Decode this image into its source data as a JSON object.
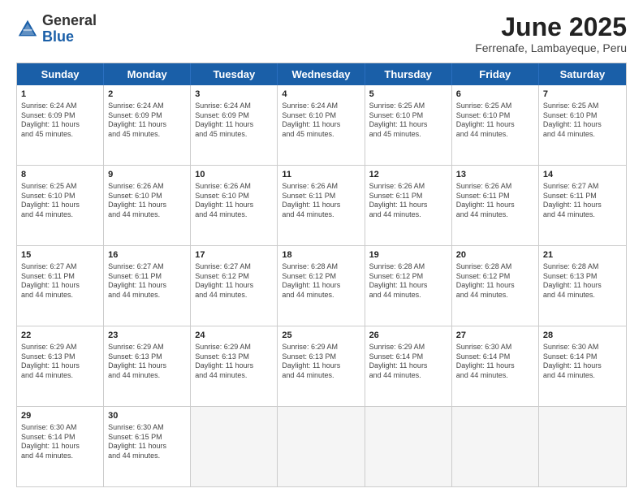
{
  "header": {
    "logo_general": "General",
    "logo_blue": "Blue",
    "month_title": "June 2025",
    "location": "Ferrenafe, Lambayeque, Peru"
  },
  "weekdays": [
    "Sunday",
    "Monday",
    "Tuesday",
    "Wednesday",
    "Thursday",
    "Friday",
    "Saturday"
  ],
  "rows": [
    [
      {
        "day": "1",
        "lines": [
          "Sunrise: 6:24 AM",
          "Sunset: 6:09 PM",
          "Daylight: 11 hours",
          "and 45 minutes."
        ]
      },
      {
        "day": "2",
        "lines": [
          "Sunrise: 6:24 AM",
          "Sunset: 6:09 PM",
          "Daylight: 11 hours",
          "and 45 minutes."
        ]
      },
      {
        "day": "3",
        "lines": [
          "Sunrise: 6:24 AM",
          "Sunset: 6:09 PM",
          "Daylight: 11 hours",
          "and 45 minutes."
        ]
      },
      {
        "day": "4",
        "lines": [
          "Sunrise: 6:24 AM",
          "Sunset: 6:10 PM",
          "Daylight: 11 hours",
          "and 45 minutes."
        ]
      },
      {
        "day": "5",
        "lines": [
          "Sunrise: 6:25 AM",
          "Sunset: 6:10 PM",
          "Daylight: 11 hours",
          "and 45 minutes."
        ]
      },
      {
        "day": "6",
        "lines": [
          "Sunrise: 6:25 AM",
          "Sunset: 6:10 PM",
          "Daylight: 11 hours",
          "and 44 minutes."
        ]
      },
      {
        "day": "7",
        "lines": [
          "Sunrise: 6:25 AM",
          "Sunset: 6:10 PM",
          "Daylight: 11 hours",
          "and 44 minutes."
        ]
      }
    ],
    [
      {
        "day": "8",
        "lines": [
          "Sunrise: 6:25 AM",
          "Sunset: 6:10 PM",
          "Daylight: 11 hours",
          "and 44 minutes."
        ]
      },
      {
        "day": "9",
        "lines": [
          "Sunrise: 6:26 AM",
          "Sunset: 6:10 PM",
          "Daylight: 11 hours",
          "and 44 minutes."
        ]
      },
      {
        "day": "10",
        "lines": [
          "Sunrise: 6:26 AM",
          "Sunset: 6:10 PM",
          "Daylight: 11 hours",
          "and 44 minutes."
        ]
      },
      {
        "day": "11",
        "lines": [
          "Sunrise: 6:26 AM",
          "Sunset: 6:11 PM",
          "Daylight: 11 hours",
          "and 44 minutes."
        ]
      },
      {
        "day": "12",
        "lines": [
          "Sunrise: 6:26 AM",
          "Sunset: 6:11 PM",
          "Daylight: 11 hours",
          "and 44 minutes."
        ]
      },
      {
        "day": "13",
        "lines": [
          "Sunrise: 6:26 AM",
          "Sunset: 6:11 PM",
          "Daylight: 11 hours",
          "and 44 minutes."
        ]
      },
      {
        "day": "14",
        "lines": [
          "Sunrise: 6:27 AM",
          "Sunset: 6:11 PM",
          "Daylight: 11 hours",
          "and 44 minutes."
        ]
      }
    ],
    [
      {
        "day": "15",
        "lines": [
          "Sunrise: 6:27 AM",
          "Sunset: 6:11 PM",
          "Daylight: 11 hours",
          "and 44 minutes."
        ]
      },
      {
        "day": "16",
        "lines": [
          "Sunrise: 6:27 AM",
          "Sunset: 6:11 PM",
          "Daylight: 11 hours",
          "and 44 minutes."
        ]
      },
      {
        "day": "17",
        "lines": [
          "Sunrise: 6:27 AM",
          "Sunset: 6:12 PM",
          "Daylight: 11 hours",
          "and 44 minutes."
        ]
      },
      {
        "day": "18",
        "lines": [
          "Sunrise: 6:28 AM",
          "Sunset: 6:12 PM",
          "Daylight: 11 hours",
          "and 44 minutes."
        ]
      },
      {
        "day": "19",
        "lines": [
          "Sunrise: 6:28 AM",
          "Sunset: 6:12 PM",
          "Daylight: 11 hours",
          "and 44 minutes."
        ]
      },
      {
        "day": "20",
        "lines": [
          "Sunrise: 6:28 AM",
          "Sunset: 6:12 PM",
          "Daylight: 11 hours",
          "and 44 minutes."
        ]
      },
      {
        "day": "21",
        "lines": [
          "Sunrise: 6:28 AM",
          "Sunset: 6:13 PM",
          "Daylight: 11 hours",
          "and 44 minutes."
        ]
      }
    ],
    [
      {
        "day": "22",
        "lines": [
          "Sunrise: 6:29 AM",
          "Sunset: 6:13 PM",
          "Daylight: 11 hours",
          "and 44 minutes."
        ]
      },
      {
        "day": "23",
        "lines": [
          "Sunrise: 6:29 AM",
          "Sunset: 6:13 PM",
          "Daylight: 11 hours",
          "and 44 minutes."
        ]
      },
      {
        "day": "24",
        "lines": [
          "Sunrise: 6:29 AM",
          "Sunset: 6:13 PM",
          "Daylight: 11 hours",
          "and 44 minutes."
        ]
      },
      {
        "day": "25",
        "lines": [
          "Sunrise: 6:29 AM",
          "Sunset: 6:13 PM",
          "Daylight: 11 hours",
          "and 44 minutes."
        ]
      },
      {
        "day": "26",
        "lines": [
          "Sunrise: 6:29 AM",
          "Sunset: 6:14 PM",
          "Daylight: 11 hours",
          "and 44 minutes."
        ]
      },
      {
        "day": "27",
        "lines": [
          "Sunrise: 6:30 AM",
          "Sunset: 6:14 PM",
          "Daylight: 11 hours",
          "and 44 minutes."
        ]
      },
      {
        "day": "28",
        "lines": [
          "Sunrise: 6:30 AM",
          "Sunset: 6:14 PM",
          "Daylight: 11 hours",
          "and 44 minutes."
        ]
      }
    ],
    [
      {
        "day": "29",
        "lines": [
          "Sunrise: 6:30 AM",
          "Sunset: 6:14 PM",
          "Daylight: 11 hours",
          "and 44 minutes."
        ]
      },
      {
        "day": "30",
        "lines": [
          "Sunrise: 6:30 AM",
          "Sunset: 6:15 PM",
          "Daylight: 11 hours",
          "and 44 minutes."
        ]
      },
      {
        "day": "",
        "lines": []
      },
      {
        "day": "",
        "lines": []
      },
      {
        "day": "",
        "lines": []
      },
      {
        "day": "",
        "lines": []
      },
      {
        "day": "",
        "lines": []
      }
    ]
  ]
}
